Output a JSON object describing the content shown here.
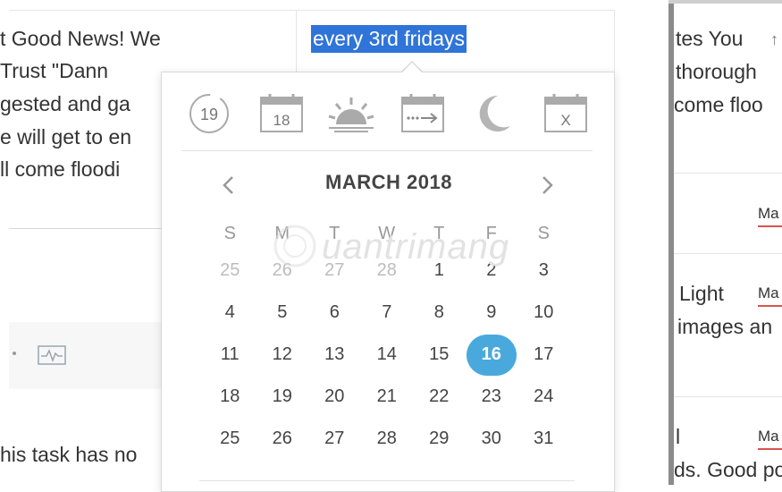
{
  "task_notes": {
    "lines": [
      "t Good News! We",
      "Trust \"Dann",
      "gested and ga",
      "e will get to en",
      "ll come floodi"
    ],
    "footer": "his task has no"
  },
  "recurrence": {
    "value": "every 3rd fridays"
  },
  "calendar": {
    "quick_icons": [
      {
        "name": "today-icon",
        "label": "19"
      },
      {
        "name": "tomorrow-icon",
        "label": "18"
      },
      {
        "name": "next-week-icon",
        "label": ""
      },
      {
        "name": "postpone-icon",
        "label": ""
      },
      {
        "name": "evening-icon",
        "label": ""
      },
      {
        "name": "no-date-icon",
        "label": "X"
      }
    ],
    "month_title": "MARCH 2018",
    "weekdays": [
      "S",
      "M",
      "T",
      "W",
      "T",
      "F",
      "S"
    ],
    "weeks": [
      [
        "25",
        "26",
        "27",
        "28",
        "1",
        "2",
        "3"
      ],
      [
        "4",
        "5",
        "6",
        "7",
        "8",
        "9",
        "10"
      ],
      [
        "11",
        "12",
        "13",
        "14",
        "15",
        "16",
        "17"
      ],
      [
        "18",
        "19",
        "20",
        "21",
        "22",
        "23",
        "24"
      ],
      [
        "25",
        "26",
        "27",
        "28",
        "29",
        "30",
        "31"
      ]
    ],
    "muted_count_first_week": 4,
    "selected_day": "16",
    "selected_color": "#4aa9dc"
  },
  "right_panel": {
    "line1": "tes You",
    "line2": "thorough",
    "line3": "come floo",
    "tag1": "Ma",
    "line4": "Light",
    "tag2": "Ma",
    "line5": "images an",
    "tag3": "Ma",
    "line6": "l",
    "line7": "ds. Good po"
  },
  "watermark": {
    "text": "uantrimang"
  },
  "colors": {
    "highlight": "#2f74d8",
    "accent": "#4aa9dc",
    "tag_underline": "#d9534f"
  }
}
